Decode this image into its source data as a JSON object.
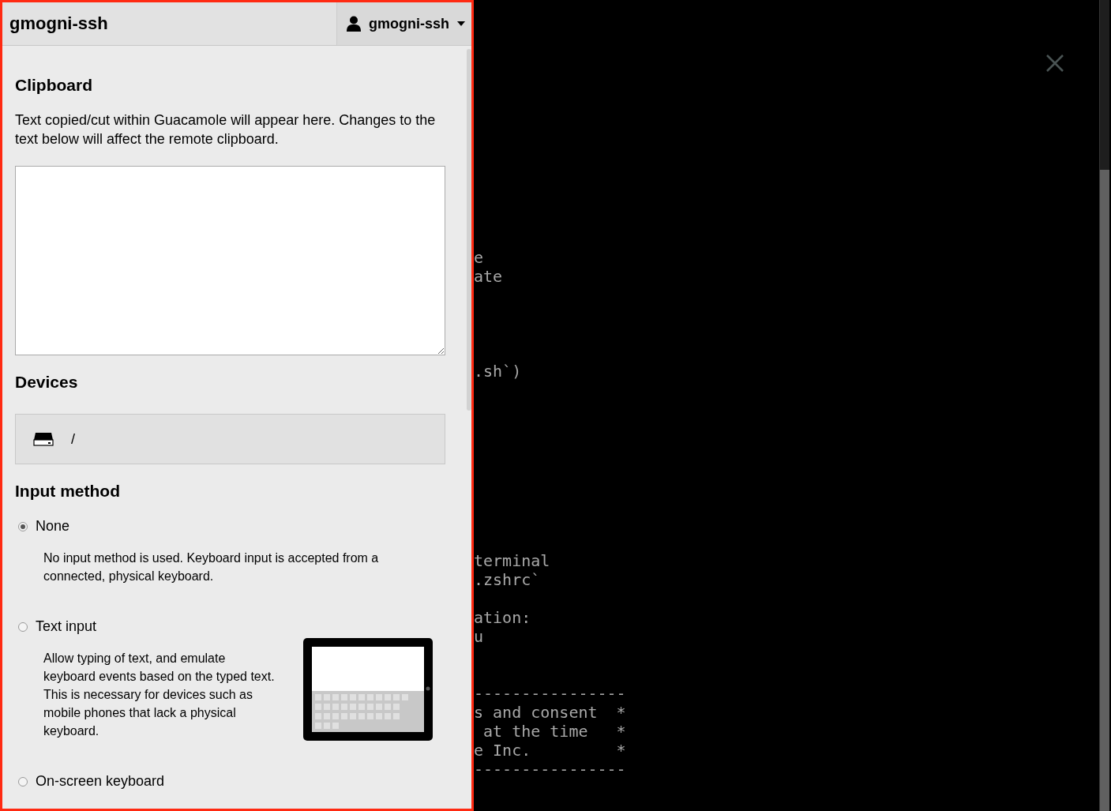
{
  "header": {
    "title": "gmogni-ssh",
    "user_menu": "gmogni-ssh"
  },
  "clipboard": {
    "heading": "Clipboard",
    "description": "Text copied/cut within Guacamole will appear here. Changes to the text below will affect the remote clipboard."
  },
  "devices": {
    "heading": "Devices",
    "items": [
      {
        "label": "/"
      }
    ]
  },
  "input_method": {
    "heading": "Input method",
    "options": [
      {
        "label": "None",
        "selected": true,
        "description": "No input method is used. Keyboard input is accepted from a connected, physical keyboard.",
        "illustration": false
      },
      {
        "label": "Text input",
        "selected": false,
        "description": "Allow typing of text, and emulate keyboard events based on the typed text. This is necessary for devices such as mobile phones that lack a physical keyboard.",
        "illustration": true
      },
      {
        "label": "On-screen keyboard",
        "selected": false
      }
    ]
  },
  "terminal": {
    "lines": [
      "e",
      "ate",
      ".sh`)",
      "terminal",
      ".zshrc`",
      "ation:",
      "u",
      "----------------",
      "s and consent  *",
      " at the time   *",
      "e Inc.         *",
      "----------------"
    ]
  }
}
